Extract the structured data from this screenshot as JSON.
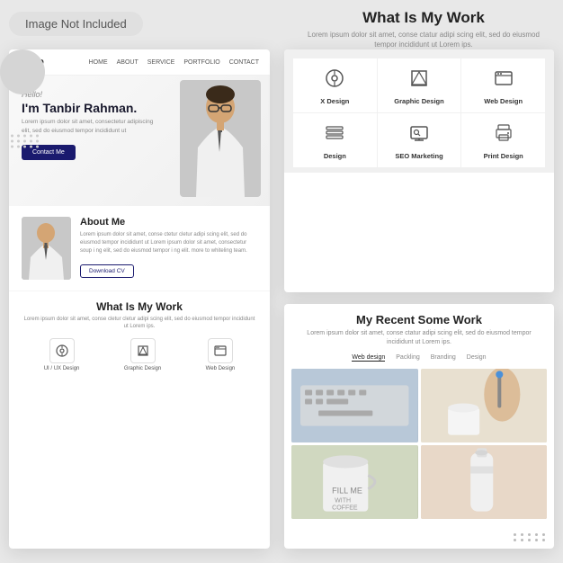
{
  "top_label": {
    "text": "Image Not Included"
  },
  "right_header": {
    "title": "What Is My Work",
    "description": "Lorem ipsum dolor sit amet, conse ctatur adipi scing elit, sed do eiusmod tempor incididunt ut Lorem ips."
  },
  "left_card": {
    "nav": {
      "logo": "Logo",
      "links": [
        "HOME",
        "ABOUT",
        "SERVICE",
        "PORTFOLIO",
        "CONTACT"
      ]
    },
    "hero": {
      "greeting": "Hello!",
      "name": "I'm Tanbir Rahman.",
      "description": "Lorem ipsum dolor sit amet, consectetur adipiscing elit, sed do eiusmod tempor incididunt ut",
      "cta_button": "Contact Me"
    },
    "about": {
      "title": "About Me",
      "description": "Lorem ipsum dolor sit amet, conse ctetur cletur adipi scing elit, sed do eiusmod tempor incididunt ut Lorem ipsum dolor sit amet, consectetur soup i ng elit, sed do eiusmod tempor i ng elit. more to whiteling team.",
      "download_button": "Download CV"
    },
    "work": {
      "title": "What Is My Work",
      "description": "Lorem ipsum dolor sit amet, conse cletur cletur adipi scing elit, sed do eiusmod tempor incididunt ut Lorem ips.",
      "services": [
        {
          "icon": "⊙",
          "label": "UI / UX Design"
        },
        {
          "icon": "◈",
          "label": "Graphic Design"
        },
        {
          "icon": "⊡",
          "label": "Web Design"
        }
      ]
    }
  },
  "right_services": {
    "services": [
      {
        "icon": "⊙",
        "label": "X Design"
      },
      {
        "icon": "◈",
        "label": "Graphic Design"
      },
      {
        "icon": "⊡",
        "label": "Web Design"
      },
      {
        "icon": "☰",
        "label": "Design"
      },
      {
        "icon": "◫",
        "label": "SEO Marketing"
      },
      {
        "icon": "⊟",
        "label": "Print Design"
      }
    ]
  },
  "recent_work": {
    "title": "My Recent Some Work",
    "description": "Lorem ipsum dolor sit amet, conse ctatur adipi scing elit, sed do eiusmod tempor incididunt ut Lorem ips.",
    "tabs": [
      {
        "label": "Web design",
        "active": true
      },
      {
        "label": "Packling",
        "active": false
      },
      {
        "label": "Branding",
        "active": false
      },
      {
        "label": "Design",
        "active": false
      }
    ]
  }
}
